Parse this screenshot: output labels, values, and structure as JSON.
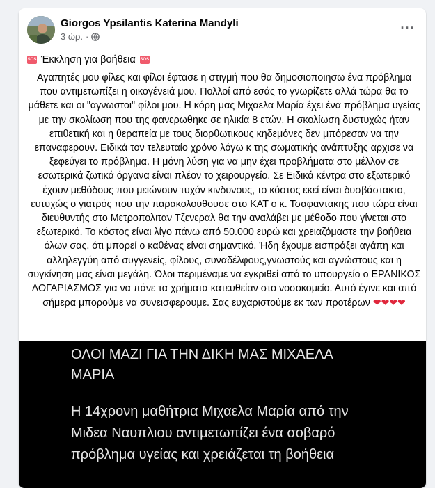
{
  "post": {
    "author": "Giorgos Ypsilantis Katerina Mandyli",
    "time": "3 ώρ.",
    "privacy_icon": "globe-icon",
    "more_icon": "more-options-icon",
    "more_label": "···",
    "title_text": "Έκκληση για βοήθεια",
    "sos_badge": "SOS",
    "body": "Αγαπητές μου φίλες και φίλοι έφτασε η στιγμή που θα δημοσιοποιησω ένα πρόβλημα που αντιμετωπίζει η οικογένειά μου. Πολλοί από εσάς το γνωρίζετε αλλά τώρα θα το μάθετε και οι \"αγνωστοι\" φίλοι μου. Η κόρη μας Μιχαελα Μαρία έχει ένα πρόβλημα υγείας με την σκολίωση που της φανερωθηκε σε ηλικία 8 ετών. Η σκολίωση δυστυχώς ήταν επιθετική και η θεραπεία με τους διορθωτικους κηδεμόνες δεν μπόρεσαν να την επαναφερουν.  Ειδικά τον τελευταίο χρόνο λόγω κ της σωματικής ανάπτυξης αρχισε να ξεφεύγει το πρόβλημα.  Η μόνη λύση για να μην έχει προβλήματα στο μέλλον σε εσωτερικά ζωτικά όργανα είναι πλέον το χειρουργείο. Σε Ειδικά κέντρα στο εξωτερικό έχουν μεθόδους που μειώνουν τυχόν κινδυνους, το κόστος εκεί είναι δυσβάστακτο,  ευτυχώς ο γιατρός που την παρακολουθουσε στο ΚΑΤ ο κ. Τσαφαντακης που τώρα είναι διευθυντής στο Μετροπολιταν Τζενεραλ θα την αναλάβει με μέθοδο που γίνεται στο εξωτερικό. Το κόστος είναι λίγο πάνω από 50.000 ευρώ και χρειαζόμαστε την βοήθεια όλων σας,  ότι μπορεί ο καθένας είναι σημαντικό.  Ήδη έχουμε εισπράξει αγάπη και αλληλεγγύη από συγγενείς, φίλους, συναδέλφους,γνωστούς και αγνώστους και η συγκίνηση μας είναι μεγάλη. Όλοι περιμέναμε να εγκριθεί από το υπουργείο ο ΕΡΑΝΙΚΟΣ ΛΟΓΑΡΙΑΣΜΟΣ για να πάνε τα χρήματα κατευθείαν στο νοσοκομείο. Αυτό έγινε και από σήμερα μπορούμε να συνεισφερουμε.  Σας ευχαριστούμε εκ των προτέρων",
    "hearts": "❤❤❤❤",
    "image_text_1": "ΟΛΟΙ ΜΑΖΙ ΓΙΑ ΤΗΝ ΔΙΚΗ ΜΑΣ ΜΙΧΑΕΛΑ ΜΑΡΙΑ",
    "image_text_2": "Η 14χρονη μαθήτρια Μιχαελα Μαρία  από την Μιδεα Ναυπλιου  αντιμετωπίζει ένα σοβαρό πρόβλημα υγείας και χρειάζεται τη βοήθεια"
  }
}
